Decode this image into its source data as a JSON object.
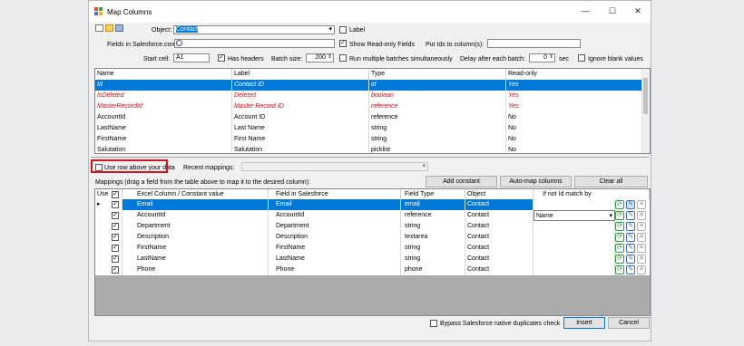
{
  "window": {
    "title": "Map Columns",
    "minimize": "—",
    "maximize": "☐",
    "close": "✕"
  },
  "form": {
    "object_label": "Object:",
    "object_value": "Contact",
    "label_checkbox": "Label",
    "fields_label": "Fields in Salesforce.com:",
    "show_readonly": "Show Read-only Fields",
    "put_ids_label": "Put Ids to column(s):",
    "start_cell_label": "Start cell:",
    "start_cell_value": "A1",
    "has_headers": "Has headers",
    "batch_size_label": "Batch size:",
    "batch_size_value": "200",
    "run_multiple": "Run multiple batches simultaneously",
    "delay_label": "Delay after each batch:",
    "delay_value": "0",
    "delay_unit": "sec",
    "ignore_blank": "Ignore blank values"
  },
  "fields_table": {
    "headers": [
      "Name",
      "Label",
      "Type",
      "Read-only"
    ],
    "rows": [
      [
        "Id",
        "Contact ID",
        "id",
        "Yes"
      ],
      [
        "IsDeleted",
        "Deleted",
        "boolean",
        "Yes"
      ],
      [
        "MasterRecordId",
        "Master Record ID",
        "reference",
        "Yes"
      ],
      [
        "AccountId",
        "Account ID",
        "reference",
        "No"
      ],
      [
        "LastName",
        "Last Name",
        "string",
        "No"
      ],
      [
        "FirstName",
        "First Name",
        "string",
        "No"
      ],
      [
        "Salutation",
        "Salutation",
        "picklist",
        "No"
      ]
    ]
  },
  "mapping_controls": {
    "use_row_above": "Use row above your data",
    "recent_mappings_label": "Recent mappings:",
    "instructions": "Mappings (drag a field from the table above to map it to the desired column):",
    "add_constant": "Add constant",
    "auto_map": "Auto-map columns",
    "clear_all": "Clear all"
  },
  "mappings_table": {
    "headers": [
      "Use",
      "Excel Column / Constant value",
      "Field in Salesforce",
      "Field Type",
      "Object",
      "If not Id match by"
    ],
    "rows": [
      {
        "excel": "Email",
        "field": "Email",
        "type": "email",
        "object": "Contact",
        "match": ""
      },
      {
        "excel": "AccountId",
        "field": "AccountId",
        "type": "reference",
        "object": "Contact",
        "match": "Name"
      },
      {
        "excel": "Department",
        "field": "Department",
        "type": "string",
        "object": "Contact",
        "match": ""
      },
      {
        "excel": "Description",
        "field": "Description",
        "type": "textarea",
        "object": "Contact",
        "match": ""
      },
      {
        "excel": "FirstName",
        "field": "FirstName",
        "type": "string",
        "object": "Contact",
        "match": ""
      },
      {
        "excel": "LastName",
        "field": "LastName",
        "type": "string",
        "object": "Contact",
        "match": ""
      },
      {
        "excel": "Phone",
        "field": "Phone",
        "type": "phone",
        "object": "Contact",
        "match": ""
      }
    ]
  },
  "footer": {
    "bypass": "Bypass Salesforce native duplicates check",
    "insert": "Insert",
    "cancel": "Cancel"
  },
  "icons": {
    "refresh": "refresh-icon",
    "wand": "wand-icon",
    "delete": "delete-icon",
    "check": "✓",
    "dropdown": "▾"
  },
  "colors": {
    "selection": "#0078d7",
    "readonly_red": "#e8000b",
    "highlight_border": "#d3151d"
  }
}
